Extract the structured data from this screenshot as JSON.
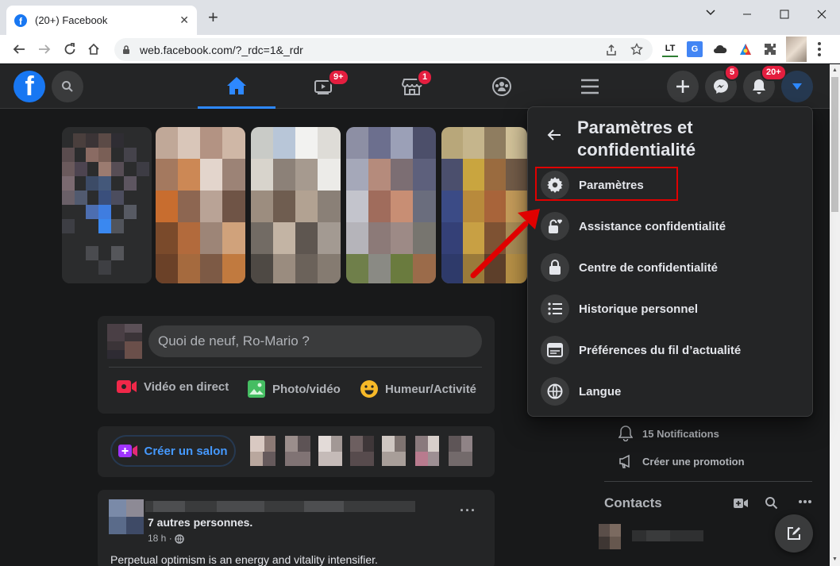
{
  "browser": {
    "tab_title": "(20+) Facebook",
    "tab_favicon": "f",
    "close_tab": "✕",
    "new_tab": "+",
    "url": "web.facebook.com/?_rdc=1&_rdr",
    "extensions": [
      "LT",
      "G",
      "cloud",
      "puzzle-a",
      "puzzle"
    ]
  },
  "header": {
    "logo": "f",
    "badges": {
      "watch": "9+",
      "marketplace": "1",
      "messenger": "5",
      "notifications": "20+"
    }
  },
  "composer": {
    "placeholder": "Quoi de neuf, Ro-Mario ?",
    "actions": [
      "Vidéo en direct",
      "Photo/vidéo",
      "Humeur/Activité"
    ]
  },
  "rooms": {
    "create_label": "Créer un salon"
  },
  "post": {
    "name_suffix": "7 autres personnes.",
    "time": "18 h ·",
    "text": "Perpetual optimism is an energy and vitality intensifier.",
    "more": "···"
  },
  "right_column": {
    "notifications": "15 Notifications",
    "promotion": "Créer une promotion",
    "contacts": "Contacts"
  },
  "dropdown": {
    "title": "Paramètres et confidentialité",
    "items": [
      {
        "label": "Paramètres",
        "icon": "gear-icon"
      },
      {
        "label": "Assistance confidentialité",
        "icon": "lock-heart-icon"
      },
      {
        "label": "Centre de confidentialité",
        "icon": "lock-icon"
      },
      {
        "label": "Historique personnel",
        "icon": "list-icon"
      },
      {
        "label": "Préférences du fil d’actualité",
        "icon": "feed-icon"
      },
      {
        "label": "Langue",
        "icon": "globe-icon"
      }
    ]
  },
  "colors": {
    "accent": "#2d88ff",
    "badge": "#e41e3f",
    "annotation": "#e00000"
  }
}
